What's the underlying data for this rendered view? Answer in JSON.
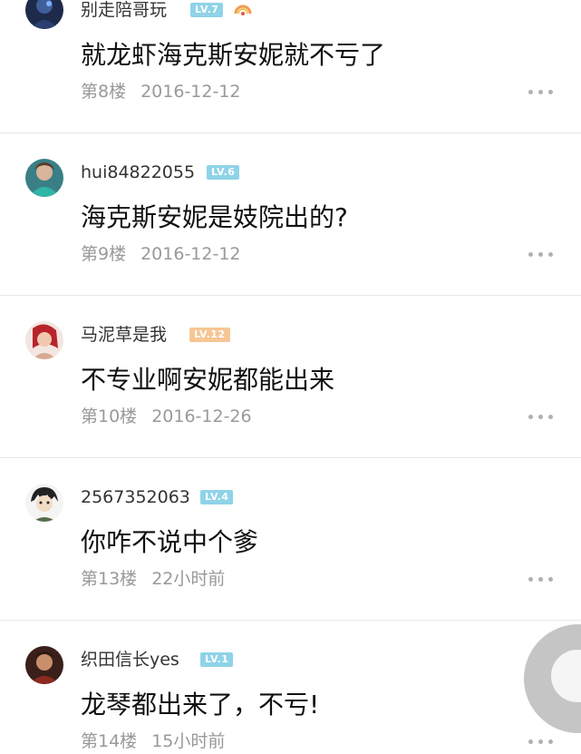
{
  "posts": [
    {
      "username": "别走陪哥玩",
      "level": "LV.7",
      "level_color": "#8fd3e8",
      "content": "就龙虾海克斯安妮就不亏了",
      "floor": "第8楼",
      "time": "2016-12-12"
    },
    {
      "username": "hui84822055",
      "level": "LV.6",
      "level_color": "#8fd3e8",
      "content": "海克斯安妮是妓院出的?",
      "floor": "第9楼",
      "time": "2016-12-12"
    },
    {
      "username": "马泥草是我",
      "level": "LV.12",
      "level_color": "#f7c694",
      "content": "不专业啊安妮都能出来",
      "floor": "第10楼",
      "time": "2016-12-26"
    },
    {
      "username": "2567352063",
      "level": "LV.4",
      "level_color": "#8fd3e8",
      "content": "你咋不说中个爹",
      "floor": "第13楼",
      "time": "22小时前"
    },
    {
      "username": "织田信长yes",
      "level": "LV.1",
      "level_color": "#8fd3e8",
      "content": "龙琴都出来了，不亏!",
      "floor": "第14楼",
      "time": "15小时前"
    }
  ]
}
